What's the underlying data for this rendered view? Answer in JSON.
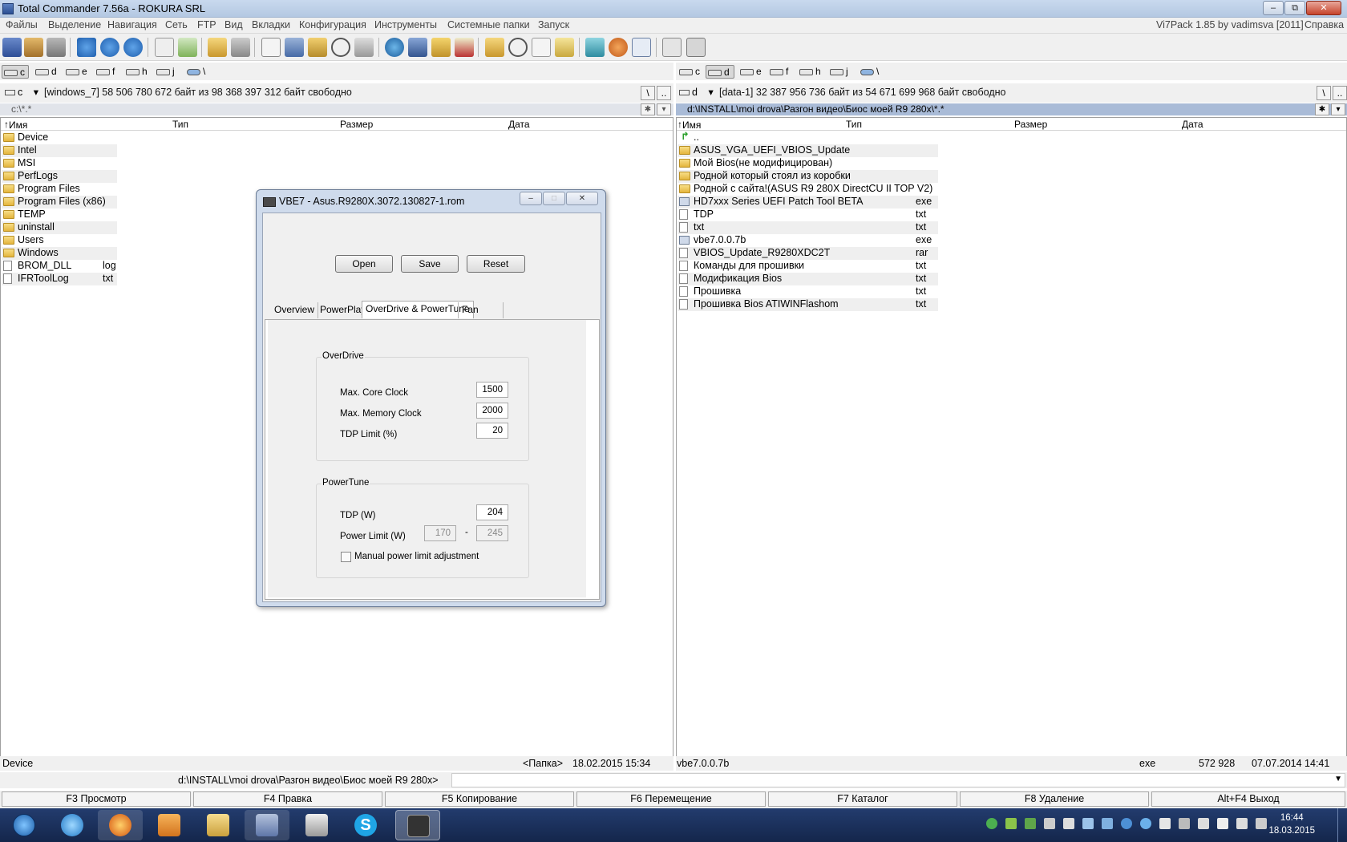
{
  "window": {
    "title": "Total Commander 7.56a - ROKURA SRL"
  },
  "menu": {
    "items": [
      "Файлы",
      "Выделение",
      "Навигация",
      "Сеть",
      "FTP",
      "Вид",
      "Вкладки",
      "Конфигурация",
      "Инструменты",
      "Системные папки",
      "Запуск"
    ],
    "right_info": "Vi7Pack 1.85 by vadimsva  [2011]",
    "help": "Справка"
  },
  "toolbar": {
    "icons": [
      "save-icon",
      "pack-icon",
      "unpack-icon",
      "refresh-icon",
      "back-icon",
      "forward-icon",
      "copy-names-icon",
      "compare-icon",
      "sync-icon",
      "view-icon",
      "multirename-icon",
      "find-icon",
      "ftp-icon",
      "ftp-connect-icon",
      "ftp-disconnect-icon",
      "favorites-icon",
      "search-icon",
      "notepad-icon",
      "properties-icon",
      "archive-icon",
      "paint-icon",
      "calc-icon",
      "settings-icon",
      "extra-icon"
    ]
  },
  "left": {
    "drives": [
      {
        "label": "c",
        "selected": true
      },
      {
        "label": "d"
      },
      {
        "label": "e"
      },
      {
        "label": "f"
      },
      {
        "label": "h"
      },
      {
        "label": "j"
      },
      {
        "label": "\\"
      }
    ],
    "drive_selector": "c",
    "free_info": "[windows_7]  58 506 780 672 байт из 98 368 397 312 байт свободно",
    "path": "c:\\*.*",
    "columns": [
      "Имя",
      "Тип",
      "Размер",
      "Дата"
    ],
    "rows": [
      {
        "name": "Device",
        "ext": "",
        "kind": "folder"
      },
      {
        "name": "Intel",
        "ext": "",
        "kind": "folder"
      },
      {
        "name": "MSI",
        "ext": "",
        "kind": "folder"
      },
      {
        "name": "PerfLogs",
        "ext": "",
        "kind": "folder"
      },
      {
        "name": "Program Files",
        "ext": "",
        "kind": "folder"
      },
      {
        "name": "Program Files (x86)",
        "ext": "",
        "kind": "folder"
      },
      {
        "name": "TEMP",
        "ext": "",
        "kind": "folder"
      },
      {
        "name": "uninstall",
        "ext": "",
        "kind": "folder"
      },
      {
        "name": "Users",
        "ext": "",
        "kind": "folder"
      },
      {
        "name": "Windows",
        "ext": "",
        "kind": "folder"
      },
      {
        "name": "BROM_DLL",
        "ext": "log",
        "kind": "file"
      },
      {
        "name": "IFRToolLog",
        "ext": "txt",
        "kind": "file"
      }
    ],
    "status": {
      "name": "Device",
      "type": "<Папка>",
      "date": "18.02.2015 15:34"
    }
  },
  "right": {
    "drives": [
      {
        "label": "c"
      },
      {
        "label": "d",
        "selected": true
      },
      {
        "label": "e"
      },
      {
        "label": "f"
      },
      {
        "label": "h"
      },
      {
        "label": "j"
      },
      {
        "label": "\\"
      }
    ],
    "drive_selector": "d",
    "free_info": "[data-1]  32 387 956 736 байт из 54 671 699 968 байт свободно",
    "path": "d:\\INSTALL\\moi drova\\Разгон видео\\Биос моей R9 280x\\*.*",
    "columns": [
      "Имя",
      "Тип",
      "Размер",
      "Дата"
    ],
    "rows": [
      {
        "name": "..",
        "ext": "",
        "kind": "up"
      },
      {
        "name": "ASUS_VGA_UEFI_VBIOS_Update",
        "ext": "",
        "kind": "folder"
      },
      {
        "name": "Мой Bios(не модифицирован)",
        "ext": "",
        "kind": "folder"
      },
      {
        "name": "Родной который стоял из коробки",
        "ext": "",
        "kind": "folder"
      },
      {
        "name": "Родной с сайта!(ASUS R9 280X DirectCU II TOP V2)",
        "ext": "",
        "kind": "folder"
      },
      {
        "name": "HD7xxx Series UEFI Patch Tool BETA",
        "ext": "exe",
        "kind": "exe"
      },
      {
        "name": "TDP",
        "ext": "txt",
        "kind": "file"
      },
      {
        "name": "txt",
        "ext": "txt",
        "kind": "file"
      },
      {
        "name": "vbe7.0.0.7b",
        "ext": "exe",
        "kind": "exe"
      },
      {
        "name": "VBIOS_Update_R9280XDC2T",
        "ext": "rar",
        "kind": "file"
      },
      {
        "name": "Команды для прошивки",
        "ext": "txt",
        "kind": "file"
      },
      {
        "name": "Модификация Bios",
        "ext": "txt",
        "kind": "file"
      },
      {
        "name": "Прошивка",
        "ext": "txt",
        "kind": "file"
      },
      {
        "name": "Прошивка Bios ATIWINFlashom",
        "ext": "txt",
        "kind": "file"
      }
    ],
    "status": {
      "name": "vbe7.0.0.7b",
      "type": "exe",
      "size": "572 928",
      "date": "07.07.2014 14:41"
    }
  },
  "cmdline": {
    "prompt": "d:\\INSTALL\\moi drova\\Разгон видео\\Биос моей R9 280x>",
    "value": ""
  },
  "fkeys": [
    "F3 Просмотр",
    "F4 Правка",
    "F5 Копирование",
    "F6 Перемещение",
    "F7 Каталог",
    "F8 Удаление",
    "Alt+F4 Выход"
  ],
  "dialog": {
    "title": "VBE7 - Asus.R9280X.3072.130827-1.rom",
    "buttons": {
      "open": "Open",
      "save": "Save",
      "reset": "Reset"
    },
    "tabs": [
      "Overview",
      "PowerPlay",
      "OverDrive & PowerTune",
      "Fan Profile"
    ],
    "active_tab": "OverDrive & PowerTune",
    "overdrive": {
      "title": "OverDrive",
      "core_clock_label": "Max. Core Clock",
      "core_clock": "1500",
      "mem_clock_label": "Max. Memory Clock",
      "mem_clock": "2000",
      "tdp_limit_label": "TDP Limit (%)",
      "tdp_limit": "20"
    },
    "powertune": {
      "title": "PowerTune",
      "tdp_label": "TDP (W)",
      "tdp": "204",
      "power_limit_label": "Power Limit (W)",
      "power_limit_min": "170",
      "power_limit_sep": "-",
      "power_limit_max": "245",
      "manual_label": "Manual power limit adjustment",
      "manual_checked": false
    }
  },
  "taskbar": {
    "items": [
      "start-orb-icon",
      "internet-explorer-icon",
      "firefox-icon",
      "outlook-icon",
      "explorer-icon",
      "total-commander-icon",
      "phone-icon",
      "skype-icon",
      "bios-editor-icon"
    ],
    "time": "16:44",
    "date": "18.03.2015"
  }
}
